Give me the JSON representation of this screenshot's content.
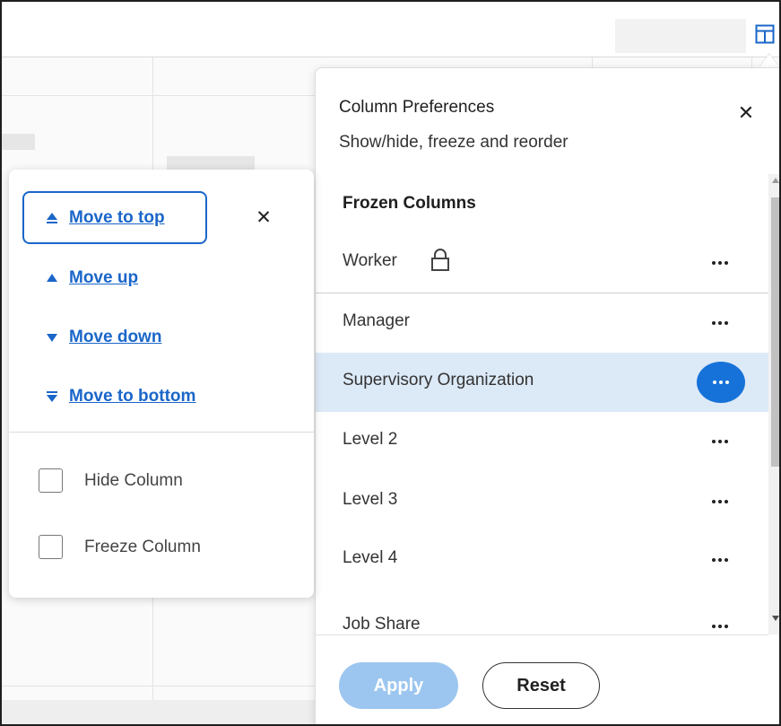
{
  "panel": {
    "title": "Column Preferences",
    "subtitle": "Show/hide, freeze and reorder",
    "close_icon": "close-icon",
    "section_heading": "Frozen Columns",
    "rows": [
      {
        "label": "Worker",
        "locked": true
      },
      {
        "label": "Manager"
      },
      {
        "label": "Supervisory Organization",
        "selected": true
      },
      {
        "label": "Level 2"
      },
      {
        "label": "Level 3"
      },
      {
        "label": "Level 4"
      },
      {
        "label": "Job Share"
      }
    ],
    "apply_label": "Apply",
    "reset_label": "Reset"
  },
  "popover": {
    "move_to_top": "Move to top",
    "move_up": "Move up",
    "move_down": "Move down",
    "move_to_bottom": "Move to bottom",
    "hide_column": "Hide Column",
    "freeze_column": "Freeze Column"
  },
  "colors": {
    "accent": "#1a66c9",
    "highlight_row": "#dce9f7",
    "apply_disabled": "#9cc6ef"
  }
}
